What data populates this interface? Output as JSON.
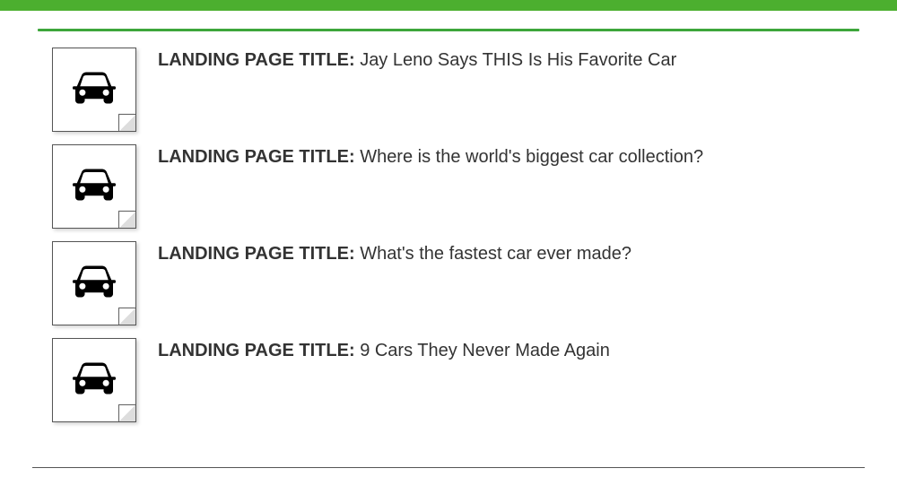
{
  "label_text": "LANDING PAGE TITLE:",
  "items": [
    {
      "title": "Jay Leno Says THIS Is His Favorite Car"
    },
    {
      "title": "Where is the world's biggest car collection?"
    },
    {
      "title": "What's the fastest car ever made?"
    },
    {
      "title": "9 Cars They Never Made Again"
    }
  ]
}
